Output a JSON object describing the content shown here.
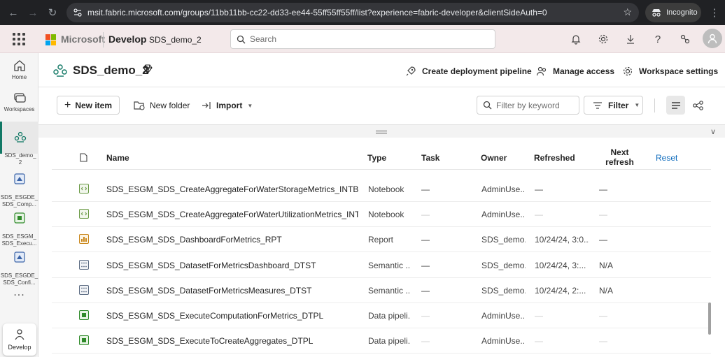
{
  "browser": {
    "url": "msit.fabric.microsoft.com/groups/11bb11bb-cc22-dd33-ee44-55ff55ff55ff/list?experience=fabric-developer&clientSideAuth=0",
    "incognito_label": "Incognito"
  },
  "header": {
    "brand": "Microsoft",
    "app_name": "Develop",
    "workspace_crumb": "SDS_demo_2",
    "search_placeholder": "Search"
  },
  "rail": {
    "items": [
      {
        "label": "Home"
      },
      {
        "label": "Workspaces"
      },
      {
        "label": "SDS_demo_\n2"
      },
      {
        "label": "SDS_ESGDE_\nSDS_Comp..."
      },
      {
        "label": "SDS_ESGM_\nSDS_Execu..."
      },
      {
        "label": "SDS_ESGDE_\nSDS_Confi..."
      }
    ],
    "more": "...",
    "develop_label": "Develop"
  },
  "workspace": {
    "title": "SDS_demo_2",
    "actions": {
      "pipeline": "Create deployment pipeline",
      "access": "Manage access",
      "settings": "Workspace settings"
    }
  },
  "toolbar": {
    "new_item": "New item",
    "new_folder": "New folder",
    "import": "Import",
    "filter_placeholder": "Filter by keyword",
    "filter": "Filter"
  },
  "table": {
    "headers": {
      "name": "Name",
      "type": "Type",
      "task": "Task",
      "owner": "Owner",
      "refreshed": "Refreshed",
      "next_refresh": "Next\nrefresh",
      "reset": "Reset"
    },
    "rows": [
      {
        "icon": "notebook-icon",
        "name": "SDS_ESGM_SDS_CreateAggregateForWaterStorageMetrics_INTB",
        "type": "Notebook",
        "task": "—",
        "owner": "AdminUse...",
        "refreshed": "—",
        "next": "—",
        "dim": false
      },
      {
        "icon": "notebook-icon",
        "name": "SDS_ESGM_SDS_CreateAggregateForWaterUtilizationMetrics_INTB",
        "type": "Notebook",
        "task": "—",
        "owner": "AdminUse...",
        "refreshed": "—",
        "next": "—",
        "dim": true
      },
      {
        "icon": "report-icon",
        "name": "SDS_ESGM_SDS_DashboardForMetrics_RPT",
        "type": "Report",
        "task": "—",
        "owner": "SDS_demo...",
        "refreshed": "10/24/24, 3:0...",
        "next": "—",
        "dim": false
      },
      {
        "icon": "semantic-model-icon",
        "name": "SDS_ESGM_SDS_DatasetForMetricsDashboard_DTST",
        "type": "Semantic ...",
        "task": "—",
        "owner": "SDS_demo...",
        "refreshed": "10/24/24, 3:...",
        "next": "N/A",
        "dim": false
      },
      {
        "icon": "semantic-model-icon",
        "name": "SDS_ESGM_SDS_DatasetForMetricsMeasures_DTST",
        "type": "Semantic ...",
        "task": "—",
        "owner": "SDS_demo...",
        "refreshed": "10/24/24, 2:...",
        "next": "N/A",
        "dim": false
      },
      {
        "icon": "pipeline-icon",
        "name": "SDS_ESGM_SDS_ExecuteComputationForMetrics_DTPL",
        "type": "Data pipeli...",
        "task": "—",
        "owner": "AdminUse...",
        "refreshed": "—",
        "next": "—",
        "dim": true
      },
      {
        "icon": "pipeline-icon",
        "name": "SDS_ESGM_SDS_ExecuteToCreateAggregates_DTPL",
        "type": "Data pipeli...",
        "task": "—",
        "owner": "AdminUse...",
        "refreshed": "—",
        "next": "—",
        "dim": true
      }
    ]
  },
  "colors": {
    "accent": "#117865",
    "header_bg": "#f3e9ea",
    "link": "#0f6cbd"
  }
}
